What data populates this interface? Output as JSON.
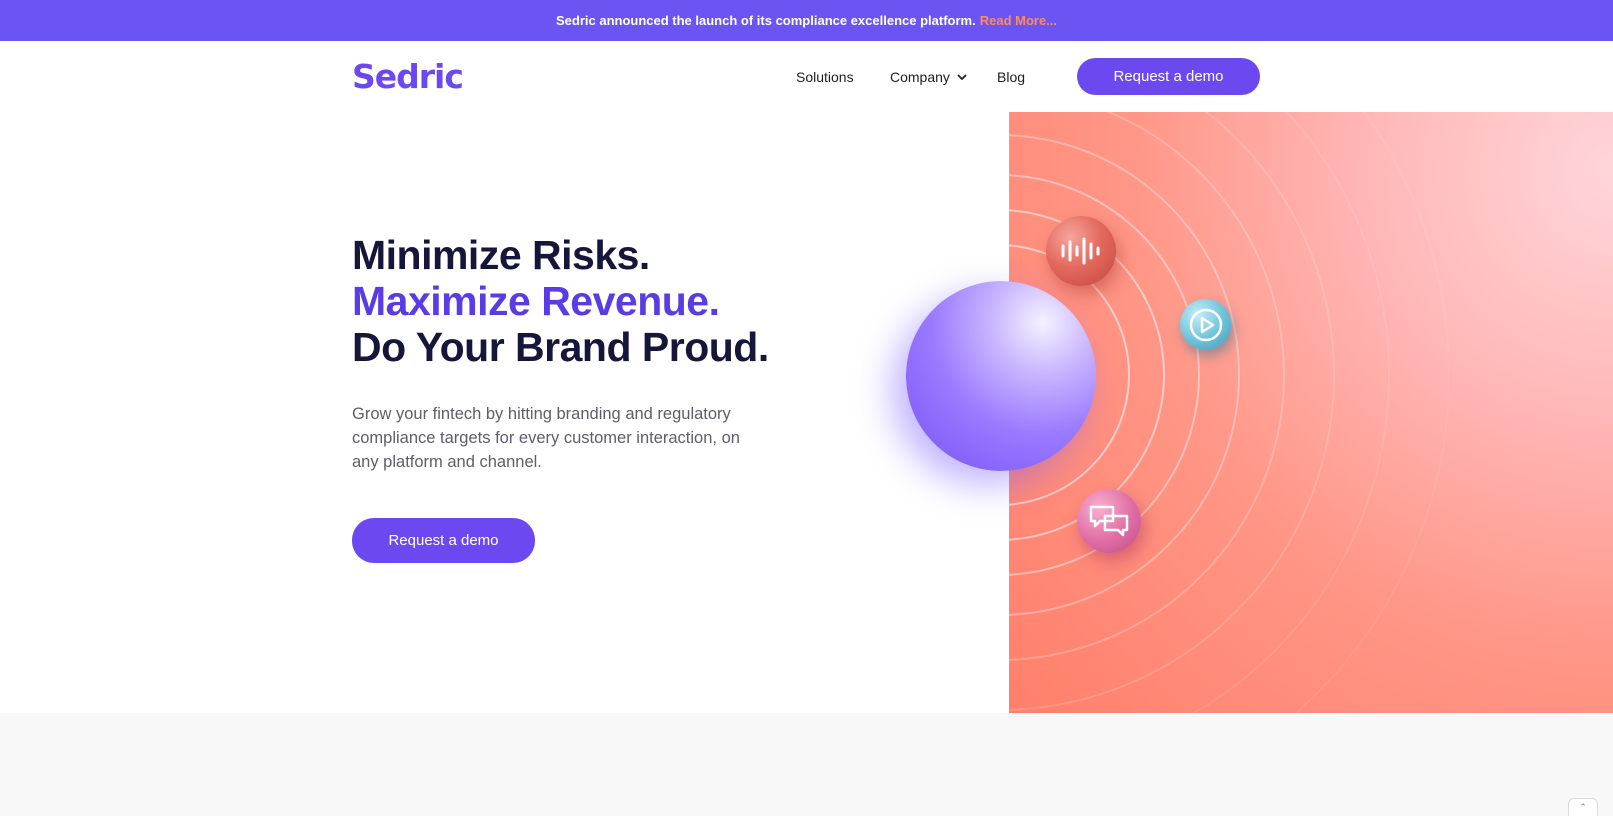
{
  "announcement": {
    "text": "Sedric announced the launch of its compliance excellence platform.",
    "link": "Read More..."
  },
  "nav": {
    "logo": "Sedric",
    "items": [
      {
        "label": "Solutions"
      },
      {
        "label": "Company",
        "icon": "chevron-down-icon"
      },
      {
        "label": "Blog"
      }
    ],
    "cta": "Request a demo"
  },
  "hero": {
    "headline_line1": "Minimize Risks.",
    "headline_line2": "Maximize Revenue.",
    "headline_line3": "Do Your Brand Proud.",
    "subtext": "Grow your fintech by hitting branding and regulatory compliance targets for every customer interaction, on any platform and channel.",
    "cta": "Request a demo",
    "icons": [
      "audio-wave-icon",
      "play-icon",
      "chat-bubbles-icon"
    ]
  },
  "scroll_top": {
    "icon": "chevron-up-icon",
    "glyph": "⌃"
  },
  "colors": {
    "brand_purple": "#6b48f0",
    "announce_bg": "#6b55f2",
    "link_orange": "#ff8a5c",
    "headline_dark": "#16163a",
    "headline_accent": "#5b3be6",
    "hero_panel": "#ff8a76"
  }
}
